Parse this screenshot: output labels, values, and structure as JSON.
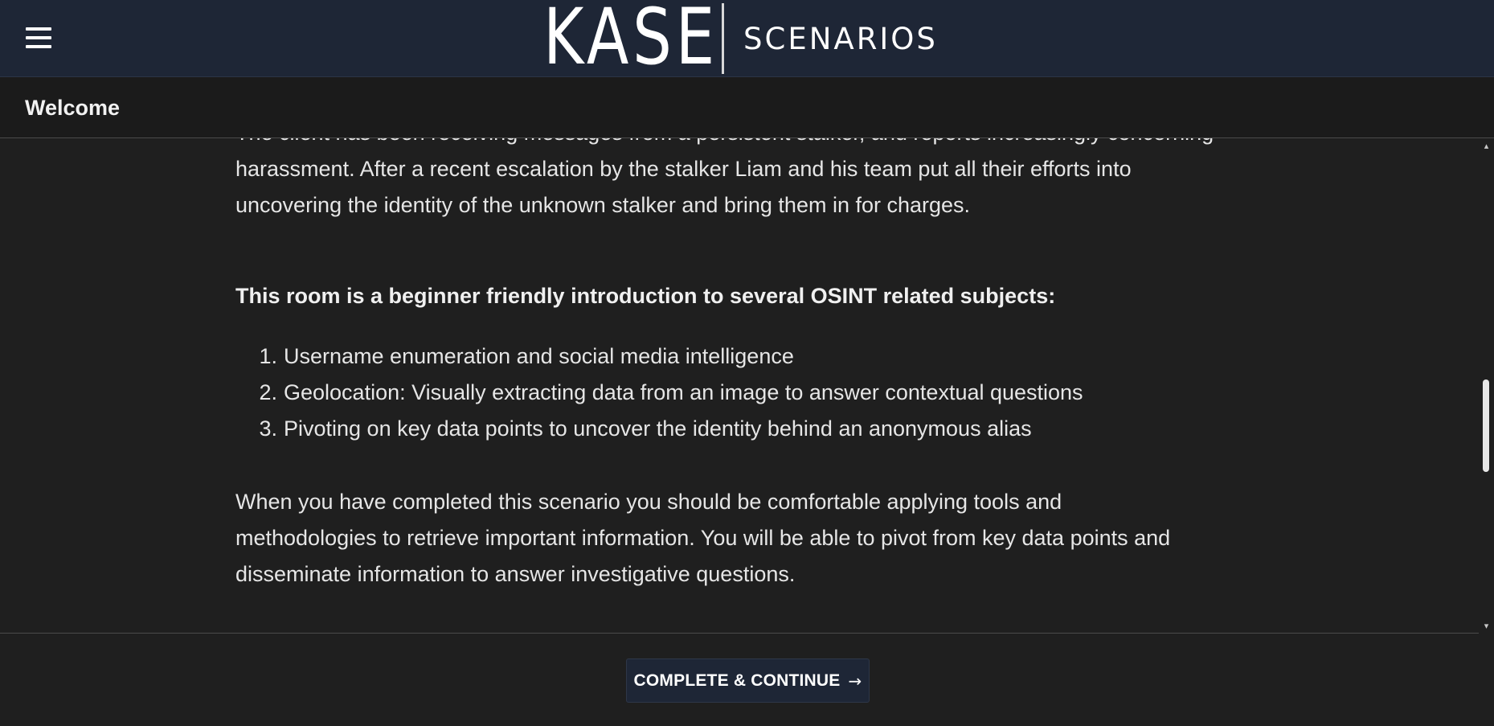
{
  "header": {
    "brand": "KASE",
    "product": "SCENARIOS",
    "menu_icon": "hamburger-menu-icon"
  },
  "subheader": {
    "title": "Welcome"
  },
  "content": {
    "clipped_paragraph_line0": "The client has been receiving messages from a persistent stalker, and reports increasingly concerning",
    "clipped_paragraph_line1": "harassment. After a recent escalation by the stalker Liam and his team put all their efforts into",
    "clipped_paragraph_line2": "uncovering the identity of the unknown stalker and bring them in for charges.",
    "heading": "This room is a beginner friendly introduction to several OSINT related subjects:",
    "goals": [
      {
        "num": "1.",
        "text": "Username enumeration and social media intelligence"
      },
      {
        "num": "2.",
        "text": "Geolocation: Visually extracting data from an image to answer contextual questions"
      },
      {
        "num": "3.",
        "text": "Pivoting on key data points to uncover the identity behind an anonymous alias"
      }
    ],
    "outro_line1": "When you have completed this scenario you should be comfortable applying tools and",
    "outro_line2": "methodologies to retrieve important information. You will be able to pivot from key data points and",
    "outro_line3": "disseminate information to answer investigative questions."
  },
  "scrollbar": {
    "up_arrow": "▴",
    "down_arrow": "▾"
  },
  "footer": {
    "continue_label": "COMPLETE & CONTINUE",
    "continue_arrow": "→"
  }
}
